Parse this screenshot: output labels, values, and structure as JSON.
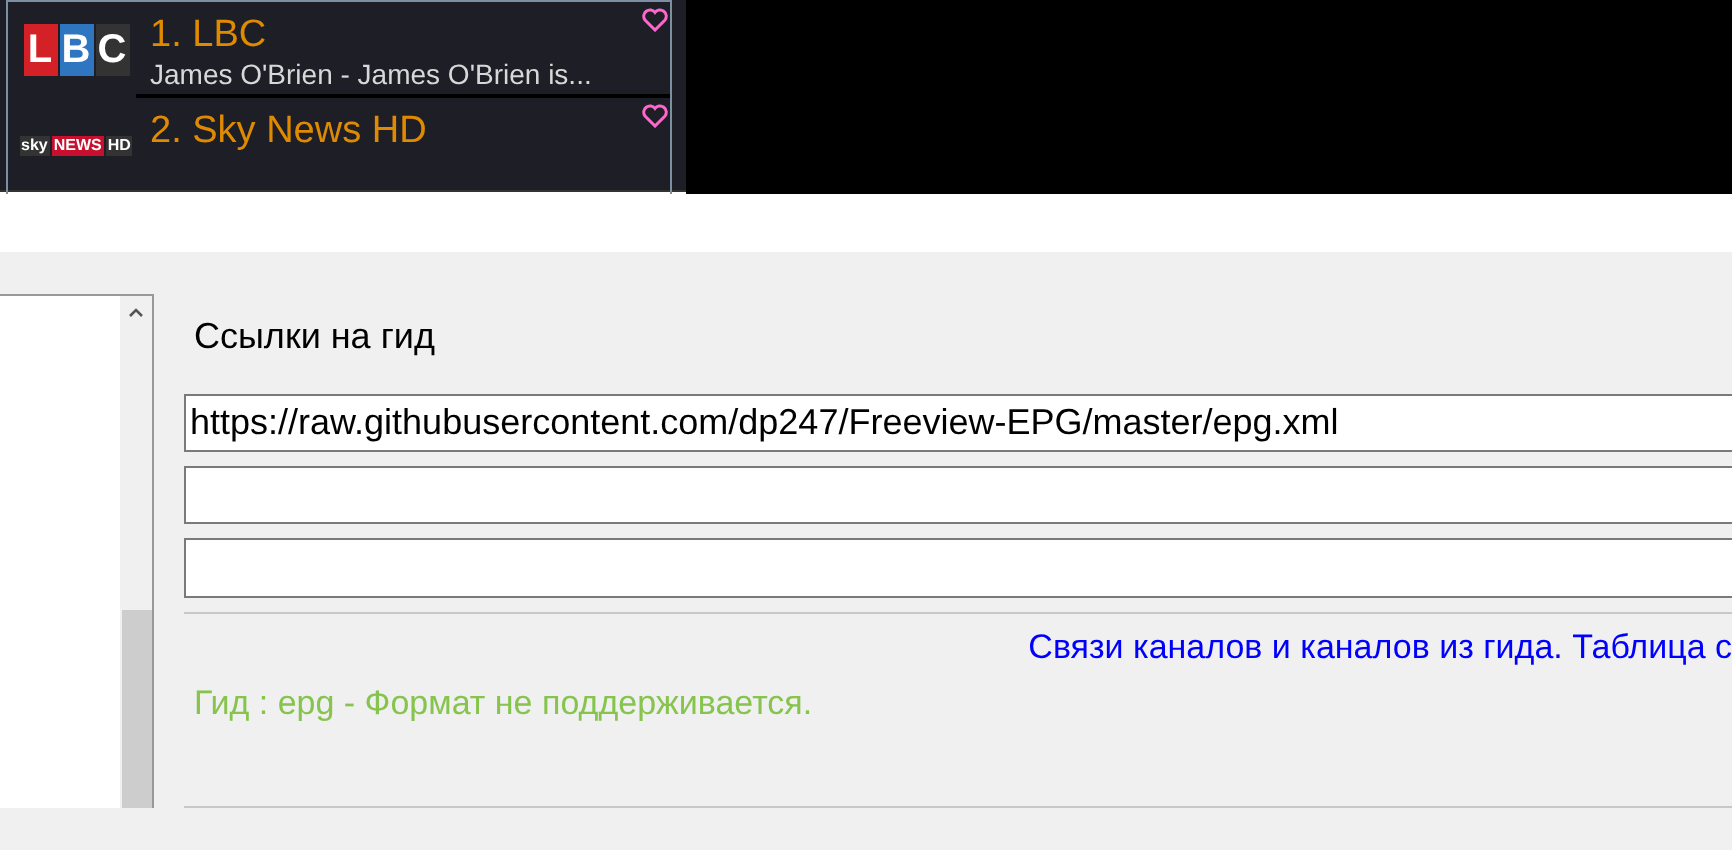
{
  "channels": [
    {
      "number": "1.",
      "name": "LBC",
      "description": "James O'Brien - James O'Brien is...",
      "favorite": true,
      "logo": [
        "L",
        "B",
        "C"
      ]
    },
    {
      "number": "2.",
      "name": "Sky News HD",
      "favorite": true,
      "logo": [
        "sky",
        "NEWS",
        "HD"
      ]
    }
  ],
  "guide": {
    "heading": "Ссылки на гид",
    "urls": [
      {
        "kind": "filled",
        "value": "https://raw.githubusercontent.com/dp247/Freeview-EPG/master/epg.xml"
      },
      {
        "kind": "blank"
      },
      {
        "kind": "blank"
      }
    ],
    "link": "Связи каналов и каналов из гида. Таблица с",
    "status": "Гид : epg - Формат не поддерживается."
  }
}
